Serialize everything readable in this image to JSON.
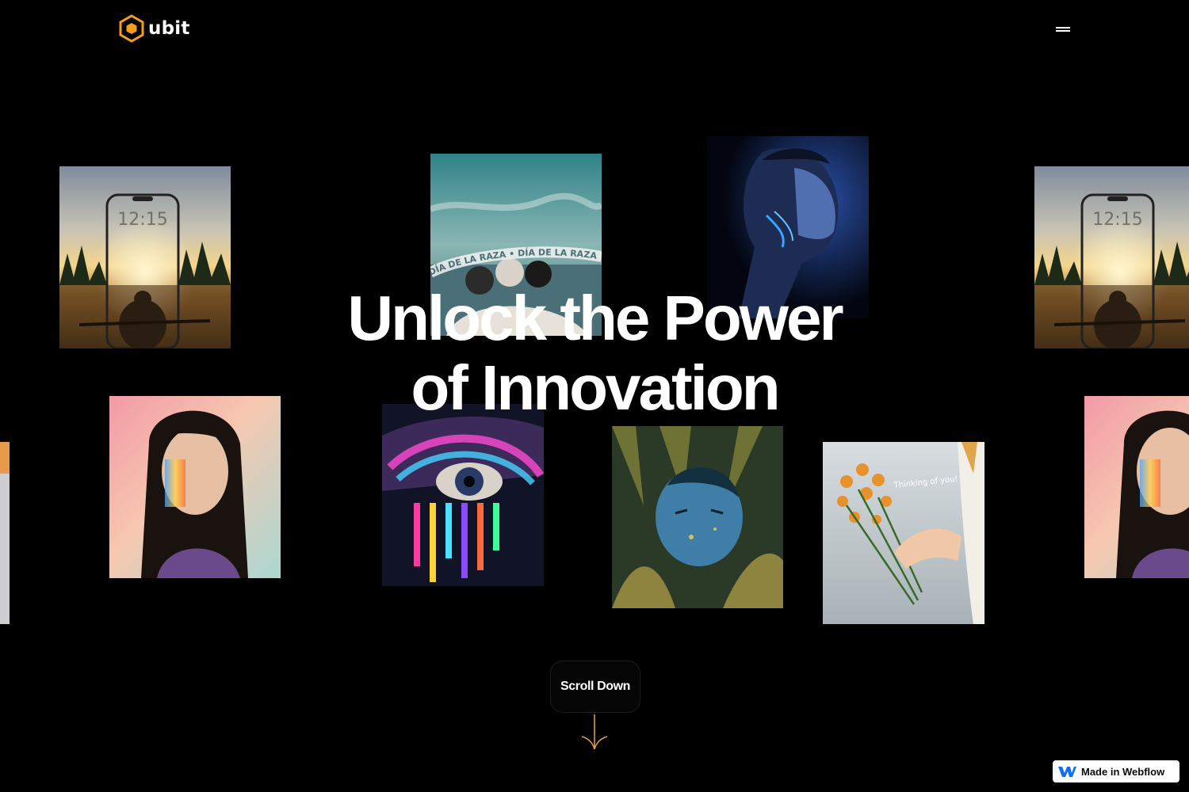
{
  "brand": {
    "name": "ubit",
    "logo_icon": "hexagon-logo-icon",
    "accent": "#f39c1d"
  },
  "nav": {
    "menu_icon": "hamburger-menu-icon"
  },
  "hero": {
    "title_line1": "Unlock the Power",
    "title_line2": "of Innovation"
  },
  "gallery": {
    "images": [
      {
        "subject": "phone lockscreen over lake kayaker",
        "clock_text": "12:15"
      },
      {
        "subject": "vintage photo with text ring",
        "ring_text": "DÍA DE LA RAZA • DÍA DE LA RAZA •"
      },
      {
        "subject": "man face with glowing blue paint"
      },
      {
        "subject": "woman portrait with rainbow light"
      },
      {
        "subject": "eye with colorful glitter makeup"
      },
      {
        "subject": "blue painted face in grass"
      },
      {
        "subject": "hand holding orange flowers",
        "caption": "Thinking of you!"
      }
    ]
  },
  "scroll": {
    "label": "Scroll Down",
    "icon": "arrow-down-icon"
  },
  "webflow_badge": {
    "label": "Made in Webflow",
    "icon": "webflow-logo-icon"
  }
}
